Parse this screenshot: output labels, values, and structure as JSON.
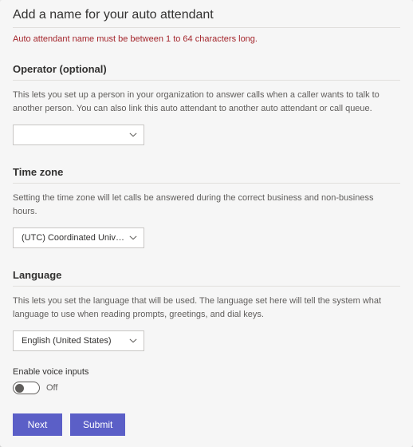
{
  "header": {
    "title": "Add a name for your auto attendant",
    "error": "Auto attendant name must be between 1 to 64 characters long."
  },
  "operator": {
    "heading": "Operator (optional)",
    "description": "This lets you set up a person in your organization to answer calls when a caller wants to talk to another person. You can also link this auto attendant to another auto attendant or call queue.",
    "selected": ""
  },
  "timezone": {
    "heading": "Time zone",
    "description": "Setting the time zone will let calls be answered during the correct business and non-business hours.",
    "selected": "(UTC) Coordinated Universal ..."
  },
  "language": {
    "heading": "Language",
    "description": "This lets you set the language that will be used. The language set here will tell the system what language to use when reading prompts, greetings, and dial keys.",
    "selected": "English (United States)"
  },
  "voice": {
    "label": "Enable voice inputs",
    "state": "Off"
  },
  "footer": {
    "next": "Next",
    "submit": "Submit"
  }
}
